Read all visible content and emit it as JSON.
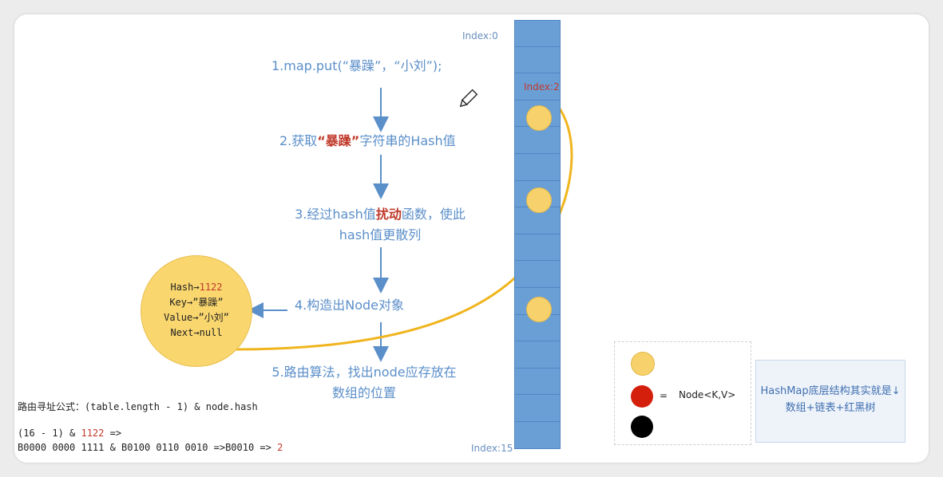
{
  "steps": {
    "s1": "1.map.put(“暴躁”，“小刘”);",
    "s2_pre": "2.获取",
    "s2_key": "“暴躁”",
    "s2_post": "字符串的Hash值",
    "s3_pre": "3.经过hash值",
    "s3_key": "扰动",
    "s3_post": "函数，使此",
    "s3_line2": "hash值更散列",
    "s4": "4.构造出Node对象",
    "s5_line1": "5.路由算法，找出node应存放在",
    "s5_line2": "数组的位置"
  },
  "array": {
    "index_top": "Index:0",
    "index_mid": "Index:2",
    "index_bottom": "Index:15"
  },
  "node": {
    "hash_label": "Hash→",
    "hash_value": "1122",
    "key": "Key→”暴躁”",
    "value": "Value→”小刘”",
    "next": "Next→null"
  },
  "formula": {
    "title": "路由寻址公式：(table.length - 1) & node.hash",
    "line1_pre": "(16 - 1) & ",
    "line1_num": "1122",
    "line1_post": " =>",
    "line2_pre": "B0000 0000 1111 & B0100 0110 0010 =>B0010 => ",
    "line2_num": "2"
  },
  "legend": {
    "eq": "=",
    "label": "Node<K,V>"
  },
  "summary": {
    "line1": "HashMap底层结构其实就是↓",
    "line2": "数组+链表+红黑树"
  },
  "colors": {
    "accent_blue": "#5b8fc9",
    "array_blue": "#6a9fd6",
    "node_yellow": "#f9d66e",
    "curve_yellow": "#f0b51e",
    "highlight_red": "#c0392b"
  }
}
